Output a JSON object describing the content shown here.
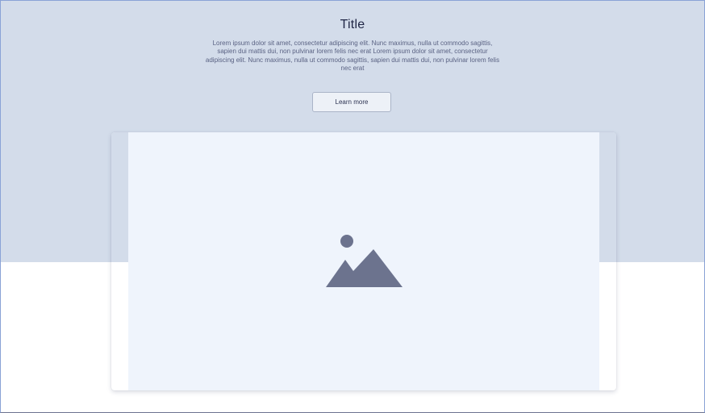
{
  "hero": {
    "title": "Title",
    "body": "Lorem ipsum dolor sit amet, consectetur adipiscing elit. Nunc maximus, nulla ut commodo sagittis, sapien dui mattis dui, non pulvinar lorem felis nec erat  Lorem ipsum dolor sit amet, consectetur adipiscing elit. Nunc maximus, nulla ut commodo sagittis, sapien dui mattis dui, non pulvinar lorem felis nec erat",
    "button_label": "Learn more"
  },
  "media": {
    "icon": "image-placeholder-icon"
  },
  "colors": {
    "hero_background": "#d3dcea",
    "image_background": "#eff4fc",
    "icon": "#6c738e",
    "title": "#1f2545"
  }
}
